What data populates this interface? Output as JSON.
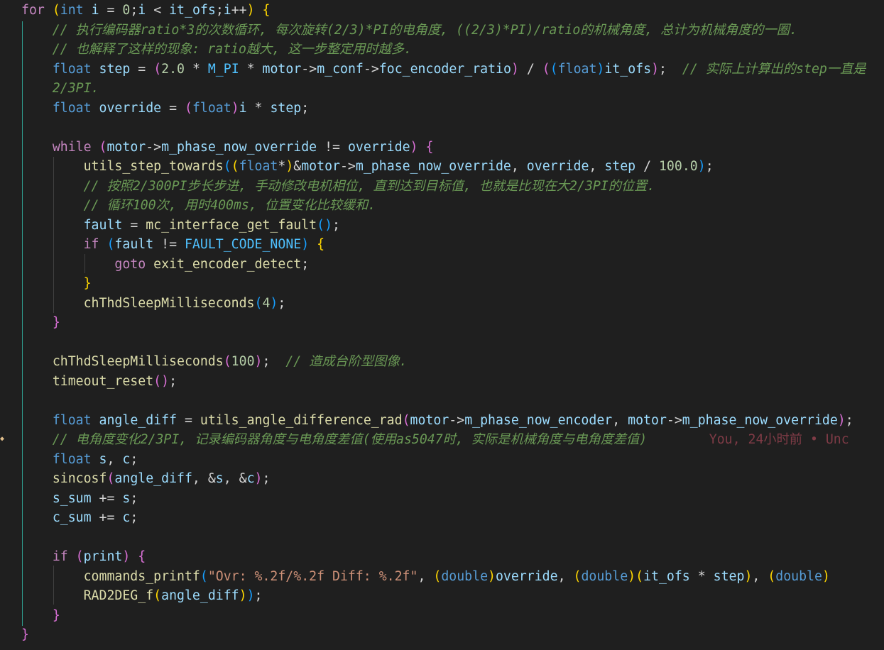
{
  "editor": {
    "lines": [
      "for (int i = 0;i < it_ofs;i++) {",
      "    // 执行编码器ratio*3的次数循环, 每次旋转(2/3)*PI的电角度, ((2/3)*PI)/ratio的机械角度, 总计为机械角度的一圈.",
      "    // 也解释了这样的现象: ratio越大, 这一步整定用时越多.",
      "    float step = (2.0 * M_PI * motor->m_conf->foc_encoder_ratio) / ((float)it_ofs);  // 实际上计算出的step一直是",
      "    2/3PI.",
      "    float override = (float)i * step;",
      "",
      "    while (motor->m_phase_now_override != override) {",
      "        utils_step_towards((float*)&motor->m_phase_now_override, override, step / 100.0);",
      "        // 按照2/300PI步长步进, 手动修改电机相位, 直到达到目标值, 也就是比现在大2/3PI的位置.",
      "        // 循环100次, 用时400ms, 位置变化比较缓和.",
      "        fault = mc_interface_get_fault();",
      "        if (fault != FAULT_CODE_NONE) {",
      "            goto exit_encoder_detect;",
      "        }",
      "        chThdSleepMilliseconds(4);",
      "    }",
      "",
      "    chThdSleepMilliseconds(100);  // 造成台阶型图像.",
      "    timeout_reset();",
      "",
      "    float angle_diff = utils_angle_difference_rad(motor->m_phase_now_encoder, motor->m_phase_now_override);",
      "    // 电角度变化2/3PI, 记录编码器角度与电角度差值(使用as5047时, 实际是机械角度与电角度差值)",
      "    float s, c;",
      "    sincosf(angle_diff, &s, &c);",
      "    s_sum += s;",
      "    c_sum += c;",
      "",
      "    if (print) {",
      "        commands_printf(\"Ovr: %.2f/%.2f Diff: %.2f\", (double)override, (double)(it_ofs * step), (double)",
      "        RAD2DEG_f(angle_diff));",
      "    }",
      "}"
    ],
    "blame_annotation": "You, 24小时前 • Unc"
  }
}
